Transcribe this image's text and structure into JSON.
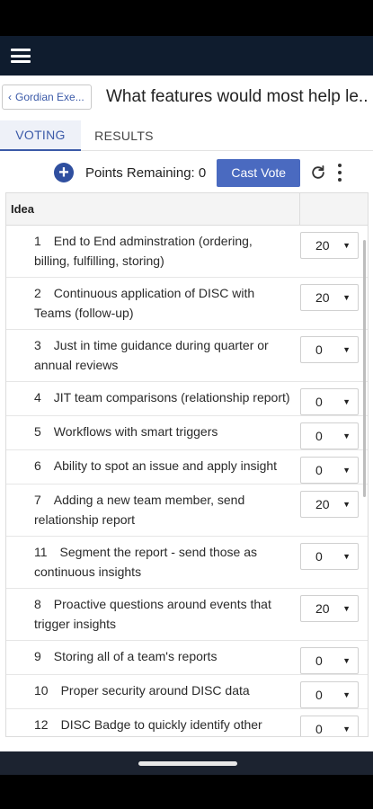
{
  "header": {
    "back_label": "Gordian Exe...",
    "title": "What features would most help le..."
  },
  "tabs": [
    {
      "label": "VOTING",
      "active": true
    },
    {
      "label": "RESULTS",
      "active": false
    }
  ],
  "toolbar": {
    "add_icon": "plus-circle-icon",
    "points_label": "Points Remaining: 0",
    "cast_label": "Cast Vote",
    "refresh_icon": "refresh-icon",
    "more_icon": "more-vertical-icon"
  },
  "grid": {
    "column_header": "Idea",
    "rows": [
      {
        "num": "1",
        "text": "End to End adminstration (ordering, billing, fulfilling, storing)",
        "value": "20"
      },
      {
        "num": "2",
        "text": "Continuous application of DISC with Teams (follow-up)",
        "value": "20"
      },
      {
        "num": "3",
        "text": "Just in time guidance during quarter or annual reviews",
        "value": "0"
      },
      {
        "num": "4",
        "text": "JIT team comparisons (relationship report)",
        "value": "0"
      },
      {
        "num": "5",
        "text": "Workflows with smart triggers",
        "value": "0"
      },
      {
        "num": "6",
        "text": "Ability to spot an issue and apply insight",
        "value": "0"
      },
      {
        "num": "7",
        "text": "Adding a new team member, send relationship report",
        "value": "20"
      },
      {
        "num": "11",
        "text": "Segment the report - send those as continuous insights",
        "value": "0"
      },
      {
        "num": "8",
        "text": "Proactive questions around events that trigger insights",
        "value": "20"
      },
      {
        "num": "9",
        "text": "Storing all of a team's reports",
        "value": "0"
      },
      {
        "num": "10",
        "text": "Proper security around DISC data",
        "value": "0"
      },
      {
        "num": "12",
        "text": "DISC Badge to quickly identify other people's types",
        "value": "0"
      }
    ]
  },
  "colors": {
    "app_bar": "#0f1c2e",
    "accent": "#3b5aa8",
    "cast_button": "#4a6ac0"
  }
}
